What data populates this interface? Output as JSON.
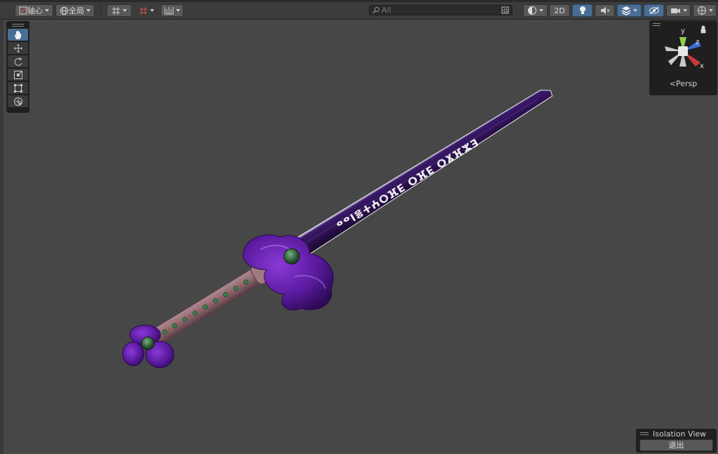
{
  "toolbar": {
    "pivot_label": "轴心",
    "global_label": "全局",
    "mode_2d_label": "2D"
  },
  "search": {
    "placeholder": "All"
  },
  "tools": {
    "items": [
      "hand-tool",
      "move-tool",
      "rotate-tool",
      "scale-tool",
      "rect-tool",
      "transform-tool"
    ],
    "active": "hand-tool"
  },
  "gizmo": {
    "axis_y": "y",
    "axis_z": "z",
    "axis_x": "x",
    "persp_label": "Persp"
  },
  "isolation": {
    "title": "Isolation View",
    "exit_label": "退出"
  },
  "sword": {
    "inscription": "ⴹⵣⴼⴳⵔ ⴺⴼⵔ ⴺⴼⵔⵖⵜⴻⵏⴰⴰ"
  },
  "colors": {
    "viewport_bg": "#474747",
    "toolbar_bg": "#3c3c3c",
    "active_blue": "#4a6d94",
    "blade": "#2a1148",
    "guard": "#5a1a9e",
    "gem": "#2f5d38",
    "grip": "#8c6a70"
  }
}
